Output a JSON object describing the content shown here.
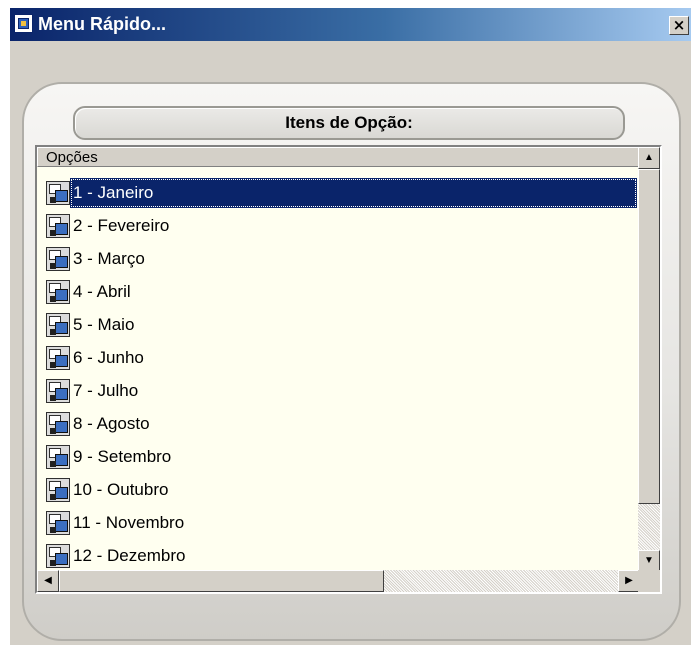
{
  "window": {
    "title": "Menu Rápido...",
    "close_glyph": "×",
    "icon": "app-icon"
  },
  "header": {
    "label": "Itens de Opção:"
  },
  "list": {
    "column_header": "Opções",
    "selected_index": 0,
    "item_icon": "window-icon",
    "items": [
      {
        "label": "1  - Janeiro"
      },
      {
        "label": "2  - Fevereiro"
      },
      {
        "label": "3  - Março"
      },
      {
        "label": "4  - Abril"
      },
      {
        "label": "5  - Maio"
      },
      {
        "label": "6  - Junho"
      },
      {
        "label": "7  - Julho"
      },
      {
        "label": "8  - Agosto"
      },
      {
        "label": "9  - Setembro"
      },
      {
        "label": "10 - Outubro"
      },
      {
        "label": "11 - Novembro"
      },
      {
        "label": "12 - Dezembro"
      }
    ]
  },
  "scrollbars": {
    "up_glyph": "▲",
    "down_glyph": "▼",
    "left_glyph": "◀",
    "right_glyph": "▶"
  },
  "colors": {
    "titlebar": "#0a246a",
    "selection": "#0a246a",
    "list_background": "#fffff0",
    "face": "#d4d0c8"
  }
}
